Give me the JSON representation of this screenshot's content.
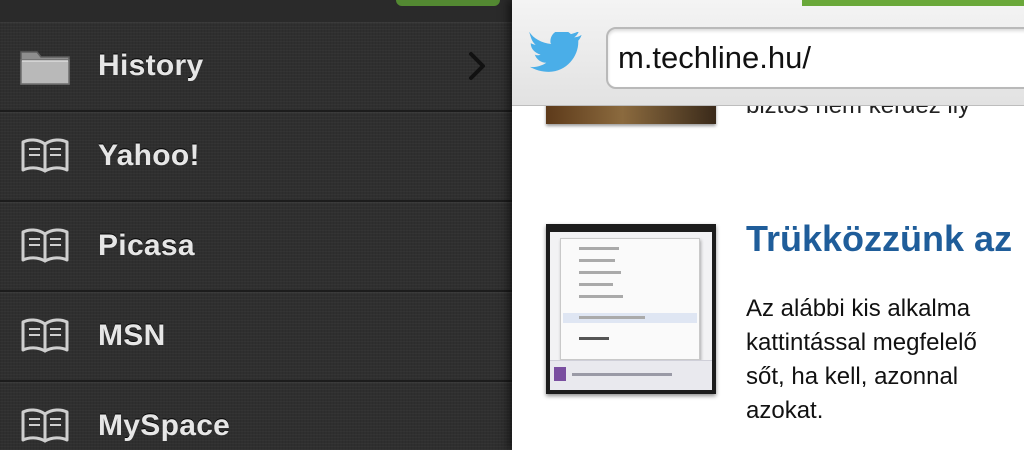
{
  "bookmarks": {
    "items": [
      {
        "label": "History",
        "icon": "folder-icon",
        "has_chevron": true
      },
      {
        "label": "Yahoo!",
        "icon": "book-icon"
      },
      {
        "label": "Picasa",
        "icon": "book-icon"
      },
      {
        "label": "MSN",
        "icon": "book-icon"
      },
      {
        "label": "MySpace",
        "icon": "book-icon"
      }
    ]
  },
  "browser": {
    "url": "m.techline.hu/",
    "share_icon": "twitter-bird-icon",
    "accent_color": "#6aa83a"
  },
  "page": {
    "partial_text": "biztos nem kérdez ily",
    "article": {
      "title": "Trükközzünk az",
      "excerpt": "Az alábbi kis alkalma\nkattintással megfelelő\nsőt, ha kell, azonnal\nazokat."
    }
  },
  "colors": {
    "link_blue": "#1f5d9a",
    "sidebar_bg": "#2f2f2f",
    "twitter_blue": "#4aaee8"
  }
}
